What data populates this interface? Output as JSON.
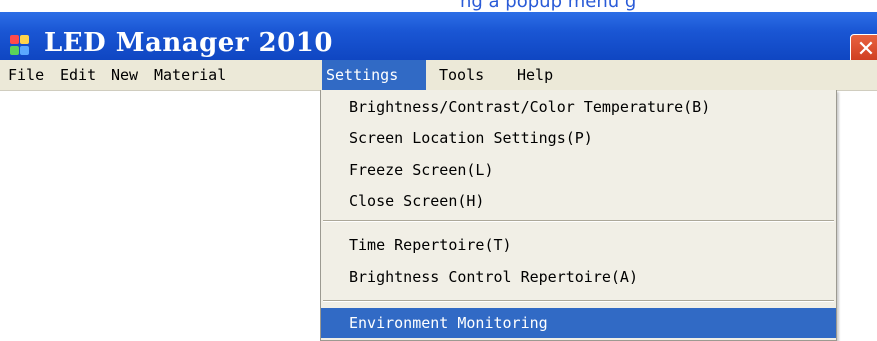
{
  "page_link_text": "ng a popup menu g",
  "window": {
    "title": "LED Manager 2010",
    "close_glyph": "✕"
  },
  "menubar": {
    "items": [
      {
        "label": "File"
      },
      {
        "label": "Edit"
      },
      {
        "label": "New"
      },
      {
        "label": "Material"
      },
      {
        "label": "Settings",
        "active": true
      },
      {
        "label": "Tools"
      },
      {
        "label": "Help"
      }
    ]
  },
  "settings_menu": {
    "items": [
      {
        "label": "Brightness/Contrast/Color Temperature(B)"
      },
      {
        "label": "Screen Location Settings(P)"
      },
      {
        "label": "Freeze Screen(L)"
      },
      {
        "label": "Close Screen(H)"
      },
      {
        "label": "Time Repertoire(T)"
      },
      {
        "label": "Brightness Control Repertoire(A)"
      },
      {
        "label": "Environment Monitoring",
        "highlighted": true
      }
    ]
  },
  "colors": {
    "titlebar": "#1a56d4",
    "menubar": "#ece9d8",
    "highlight": "#316ac5",
    "close_button": "#d9482a",
    "link": "#2a5bd7"
  },
  "icons": {
    "app_icon": "led-app-icon",
    "close_icon": "close-icon"
  }
}
